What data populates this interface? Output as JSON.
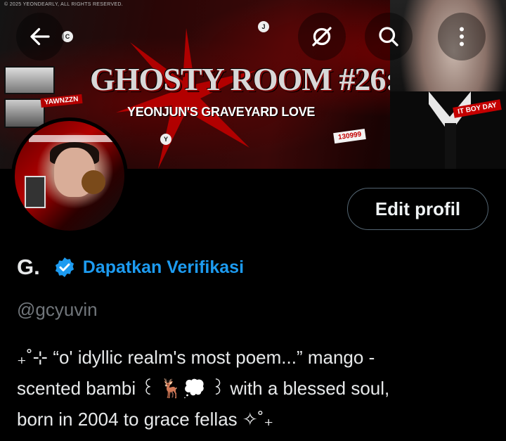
{
  "banner": {
    "copyright": "© 2025 YEONDEARLY, ALL RIGHTS RESERVED.",
    "title": "GHOSTY ROOM #26:",
    "subtitle": "YEONJUN'S GRAVEYARD LOVE",
    "tag_left": "YAWNZZN",
    "tag_number": "130999",
    "tag_right": "IT BOY DAY",
    "letter_j": "J",
    "letter_c": "C",
    "letter_y": "Y"
  },
  "header": {
    "back_icon": "arrow-left-icon",
    "mute_icon": "notifications-off-icon",
    "search_icon": "search-icon",
    "more_icon": "more-vertical-icon"
  },
  "profile": {
    "edit_label": "Edit profil",
    "display_name": "G.",
    "verify_label": "Dapatkan Verifikasi",
    "handle": "@gcyuvin",
    "bio_lines": [
      "₊˚⊹ “o' idyllic realm's most poem...” mango -",
      "scented bambi ꒰ 🦌💭 ꒱ with a blessed soul,",
      "born in 2004 to grace fellas ✧˚₊"
    ]
  },
  "colors": {
    "background": "#000000",
    "accent": "#1d9bf0",
    "secondary_text": "#71767b",
    "border": "#536471"
  }
}
